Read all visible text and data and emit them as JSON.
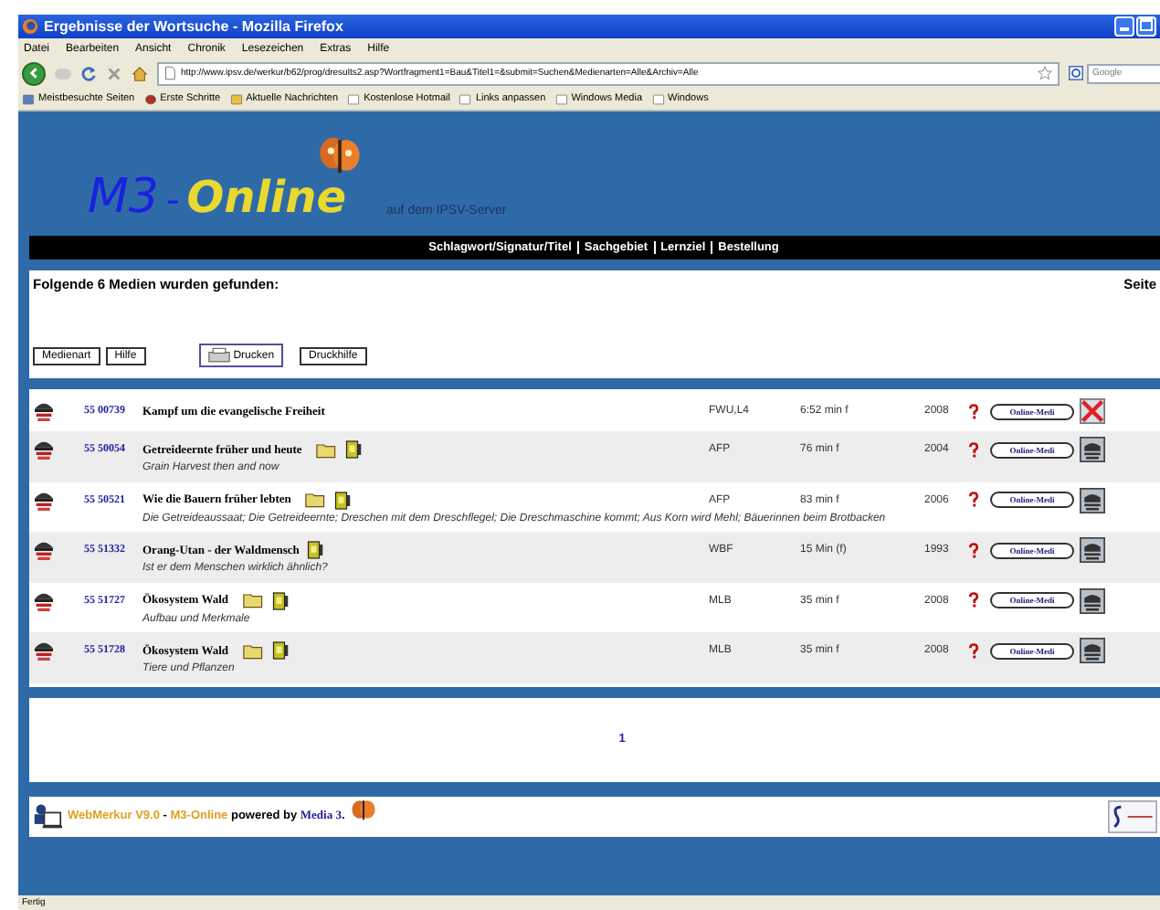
{
  "window": {
    "title": "Ergebnisse der Wortsuche - Mozilla Firefox"
  },
  "menu": [
    "Datei",
    "Bearbeiten",
    "Ansicht",
    "Chronik",
    "Lesezeichen",
    "Extras",
    "Hilfe"
  ],
  "address": {
    "value": "http://www.ipsv.de/werkur/b62/prog/dresults2.asp?Wortfragment1=Bau&Titel1=&submit=Suchen&Medienarten=Alle&Archiv=Alle"
  },
  "search": {
    "placeholder": "Google"
  },
  "bookmarks": [
    {
      "label": "Meistbesuchte Seiten",
      "kind": "feed"
    },
    {
      "label": "Erste Schritte",
      "kind": "firefox"
    },
    {
      "label": "Aktuelle Nachrichten",
      "kind": "folder"
    },
    {
      "label": "Kostenlose Hotmail",
      "kind": "page"
    },
    {
      "label": "Links anpassen",
      "kind": "page"
    },
    {
      "label": "Windows Media",
      "kind": "page"
    },
    {
      "label": "Windows",
      "kind": "page"
    }
  ],
  "header": {
    "logo_main": "M3",
    "logo_dash": "-",
    "logo_word": "Online",
    "server": "auf dem IPSV-Server"
  },
  "nav": [
    "Schlagwort/Signatur/Titel",
    "Sachgebiet",
    "Lernziel",
    "Bestellung"
  ],
  "results": {
    "heading": "Folgende 6 Medien wurden gefunden:",
    "page_label": "Seite"
  },
  "buttons": [
    {
      "label": "Medienart",
      "kind": "plain"
    },
    {
      "label": "Hilfe",
      "kind": "plain"
    },
    {
      "label": "Drucken",
      "kind": "print"
    },
    {
      "label": "Druckhilfe",
      "kind": "plain"
    }
  ],
  "rows": [
    {
      "signature": "55 00739",
      "title": "Kampf um die evangelische Freiheit",
      "folder": false,
      "film": false,
      "producer": "FWU,L4",
      "duration": "6:52 min f",
      "year": "2008",
      "button": "Online-Medi",
      "available": false
    },
    {
      "signature": "55 50054",
      "title": "Getreideernte früher und heute",
      "subtitle": "Grain Harvest then and now",
      "folder": true,
      "film": true,
      "producer": "AFP",
      "duration": "76 min f",
      "year": "2004",
      "button": "Online-Medi",
      "available": true
    },
    {
      "signature": "55 50521",
      "title": "Wie die Bauern früher lebten",
      "subtitle": "Die Getreideaussaat; Die Getreideernte; Dreschen mit dem Dreschflegel; Die Dreschmaschine kommt; Aus Korn wird Mehl; Bäuerinnen beim Brotbacken",
      "folder": true,
      "film": true,
      "producer": "AFP",
      "duration": "83 min f",
      "year": "2006",
      "button": "Online-Medi",
      "available": true
    },
    {
      "signature": "55 51332",
      "title": "Orang-Utan - der Waldmensch",
      "subtitle": "Ist er dem Menschen wirklich ähnlich?",
      "folder": false,
      "film": true,
      "producer": "WBF",
      "duration": "15 Min (f)",
      "year": "1993",
      "button": "Online-Medi",
      "available": true
    },
    {
      "signature": "55 51727",
      "title": "Ökosystem Wald",
      "subtitle": "Aufbau und Merkmale",
      "folder": true,
      "film": true,
      "producer": "MLB",
      "duration": "35 min f",
      "year": "2008",
      "button": "Online-Medi",
      "available": true
    },
    {
      "signature": "55 51728",
      "title": "Ökosystem Wald",
      "subtitle": "Tiere und Pflanzen",
      "folder": true,
      "film": true,
      "producer": "MLB",
      "duration": "35 min f",
      "year": "2008",
      "button": "Online-Medi",
      "available": true
    }
  ],
  "pagination": [
    "1"
  ],
  "footer": {
    "product": "WebMerkur V9.0",
    "separator": "-",
    "site": "M3-Online",
    "powered": "powered by",
    "company": "Media 3",
    "end": "."
  },
  "status_bar": "Fertig"
}
